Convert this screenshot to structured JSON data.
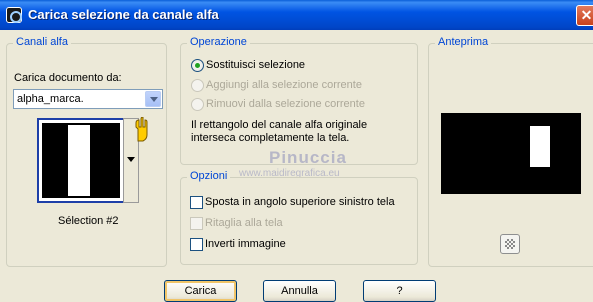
{
  "window": {
    "title": "Carica selezione da canale alfa",
    "close_glyph": "✕"
  },
  "alpha_channels": {
    "legend": "Canali alfa",
    "load_doc_label": "Carica documento da:",
    "document_value": "alpha_marca.",
    "selection_name": "Sélection #2"
  },
  "operation": {
    "legend": "Operazione",
    "options": [
      {
        "label": "Sostituisci selezione",
        "checked": true,
        "enabled": true
      },
      {
        "label": "Aggiungi alla selezione corrente",
        "checked": false,
        "enabled": false
      },
      {
        "label": "Rimuovi dalla selezione corrente",
        "checked": false,
        "enabled": false
      }
    ],
    "info_line1": "Il rettangolo del canale alfa originale",
    "info_line2": "interseca completamente la tela."
  },
  "options": {
    "legend": "Opzioni",
    "items": [
      {
        "label": "Sposta in angolo superiore sinistro tela",
        "checked": false,
        "enabled": true
      },
      {
        "label": "Ritaglia alla tela",
        "checked": false,
        "enabled": false
      },
      {
        "label": "Inverti immagine",
        "checked": false,
        "enabled": true
      }
    ]
  },
  "preview": {
    "legend": "Anteprima"
  },
  "buttons": {
    "load": "Carica",
    "cancel": "Annulla",
    "help": "?"
  },
  "watermark": {
    "name": "Pinuccia",
    "url": "www.maidiregrafica.eu"
  }
}
